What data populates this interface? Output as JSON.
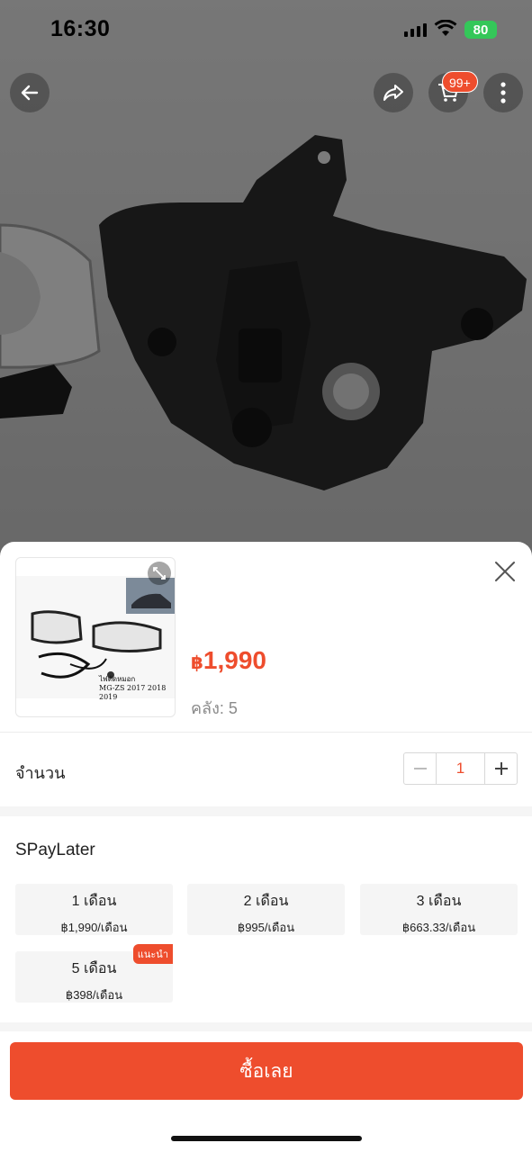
{
  "status_bar": {
    "time": "16:30",
    "battery": "80"
  },
  "nav": {
    "cart_badge": "99+"
  },
  "thumbnail": {
    "caption_line1": "ไฟตัดหมอก",
    "caption_line2": "MG-ZS 2017 2018 2019"
  },
  "product": {
    "currency": "฿",
    "price": "1,990",
    "stock": "คลัง: 5"
  },
  "quantity": {
    "label": "จำนวน",
    "value": "1"
  },
  "spaylater": {
    "title": "SPayLater",
    "plans": [
      {
        "months": "1 เดือน",
        "rate": "฿1,990/เดือน"
      },
      {
        "months": "2 เดือน",
        "rate": "฿995/เดือน"
      },
      {
        "months": "3 เดือน",
        "rate": "฿663.33/เดือน"
      },
      {
        "months": "5 เดือน",
        "rate": "฿398/เดือน",
        "badge": "แนะนำ"
      }
    ]
  },
  "buy_now": {
    "label": "ซื้อเลย"
  },
  "colors": {
    "accent": "#ee4d2d",
    "battery": "#34c759"
  }
}
